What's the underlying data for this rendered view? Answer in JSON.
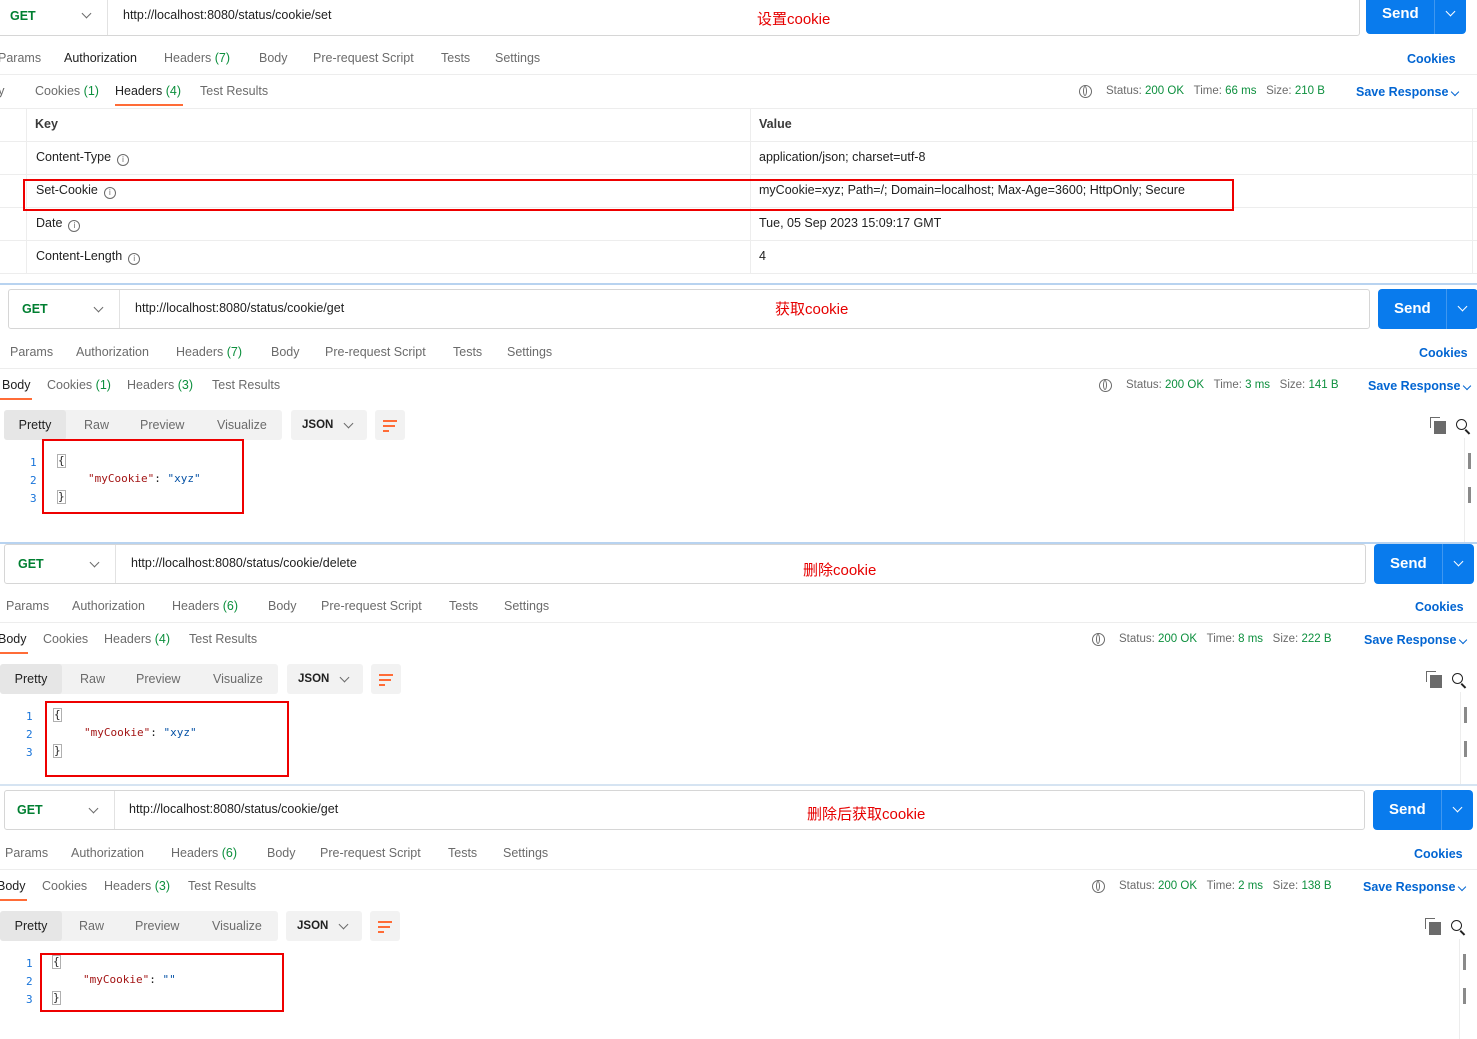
{
  "common": {
    "send_label": "Send",
    "request_tabs": [
      "Params",
      "Authorization",
      "Headers",
      "Body",
      "Pre-request Script",
      "Tests",
      "Settings"
    ],
    "cookies_link": "Cookies",
    "response_tabs": [
      "Body",
      "Cookies",
      "Headers",
      "Test Results"
    ],
    "status_label": "Status:",
    "status_value": "200 OK",
    "time_label": "Time:",
    "size_label": "Size:",
    "save_response": "Save Response",
    "view_modes": [
      "Pretty",
      "Raw",
      "Preview",
      "Visualize"
    ],
    "format": "JSON",
    "colors": {
      "send": "#097bed",
      "accent": "#ff6c37",
      "method": "#007f31",
      "annotation": "#e60000"
    }
  },
  "panels": [
    {
      "method": "GET",
      "url": "http://localhost:8080/status/cookie/set",
      "annotation": "设置cookie",
      "request_headers_count": "(7)",
      "response_cookies_count": "(1)",
      "response_headers_count": "(4)",
      "active_response_tab": "Headers",
      "time": "66 ms",
      "size": "210 B",
      "headers_table": {
        "col_key": "Key",
        "col_value": "Value",
        "rows": [
          {
            "key": "Content-Type",
            "value": "application/json; charset=utf-8"
          },
          {
            "key": "Set-Cookie",
            "value": "myCookie=xyz; Path=/; Domain=localhost; Max-Age=3600; HttpOnly; Secure"
          },
          {
            "key": "Date",
            "value": "Tue, 05 Sep 2023 15:09:17 GMT"
          },
          {
            "key": "Content-Length",
            "value": "4"
          }
        ]
      }
    },
    {
      "method": "GET",
      "url": "http://localhost:8080/status/cookie/get",
      "annotation": "获取cookie",
      "request_headers_count": "(7)",
      "response_cookies_count": "(1)",
      "response_headers_count": "(3)",
      "active_response_tab": "Body",
      "time": "3 ms",
      "size": "141 B",
      "body": {
        "lines": [
          "1",
          "2",
          "3"
        ],
        "key": "\"myCookie\"",
        "value": "\"xyz\""
      }
    },
    {
      "method": "GET",
      "url": "http://localhost:8080/status/cookie/delete",
      "annotation": "删除cookie",
      "request_headers_count": "(6)",
      "response_cookies_count": "",
      "response_headers_count": "(4)",
      "active_response_tab": "Body",
      "time": "8 ms",
      "size": "222 B",
      "body": {
        "lines": [
          "1",
          "2",
          "3"
        ],
        "key": "\"myCookie\"",
        "value": "\"xyz\""
      }
    },
    {
      "method": "GET",
      "url": "http://localhost:8080/status/cookie/get",
      "annotation": "删除后获取cookie",
      "request_headers_count": "(6)",
      "response_cookies_count": "",
      "response_headers_count": "(3)",
      "active_response_tab": "Body",
      "time": "2 ms",
      "size": "138 B",
      "body": {
        "lines": [
          "1",
          "2",
          "3"
        ],
        "key": "\"myCookie\"",
        "value": "\"\""
      }
    }
  ]
}
